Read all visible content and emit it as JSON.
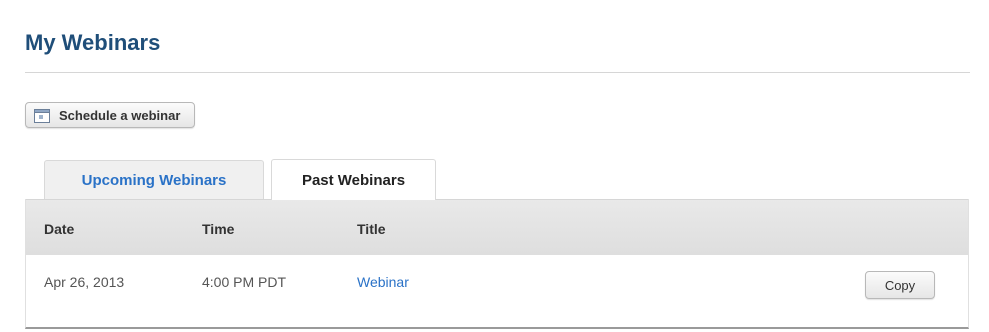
{
  "page": {
    "title": "My Webinars"
  },
  "toolbar": {
    "schedule_label": "Schedule a webinar",
    "schedule_icon": "calendar-icon"
  },
  "tabs": [
    {
      "label": "Upcoming Webinars",
      "active": false
    },
    {
      "label": "Past Webinars",
      "active": true
    }
  ],
  "table": {
    "columns": [
      "Date",
      "Time",
      "Title"
    ],
    "rows": [
      {
        "date": "Apr 26, 2013",
        "time": "4:00 PM PDT",
        "title": "Webinar",
        "action_label": "Copy"
      }
    ]
  },
  "colors": {
    "title": "#1f4e79",
    "link": "#2a72c7",
    "header_bg": "#e4e4e4"
  }
}
